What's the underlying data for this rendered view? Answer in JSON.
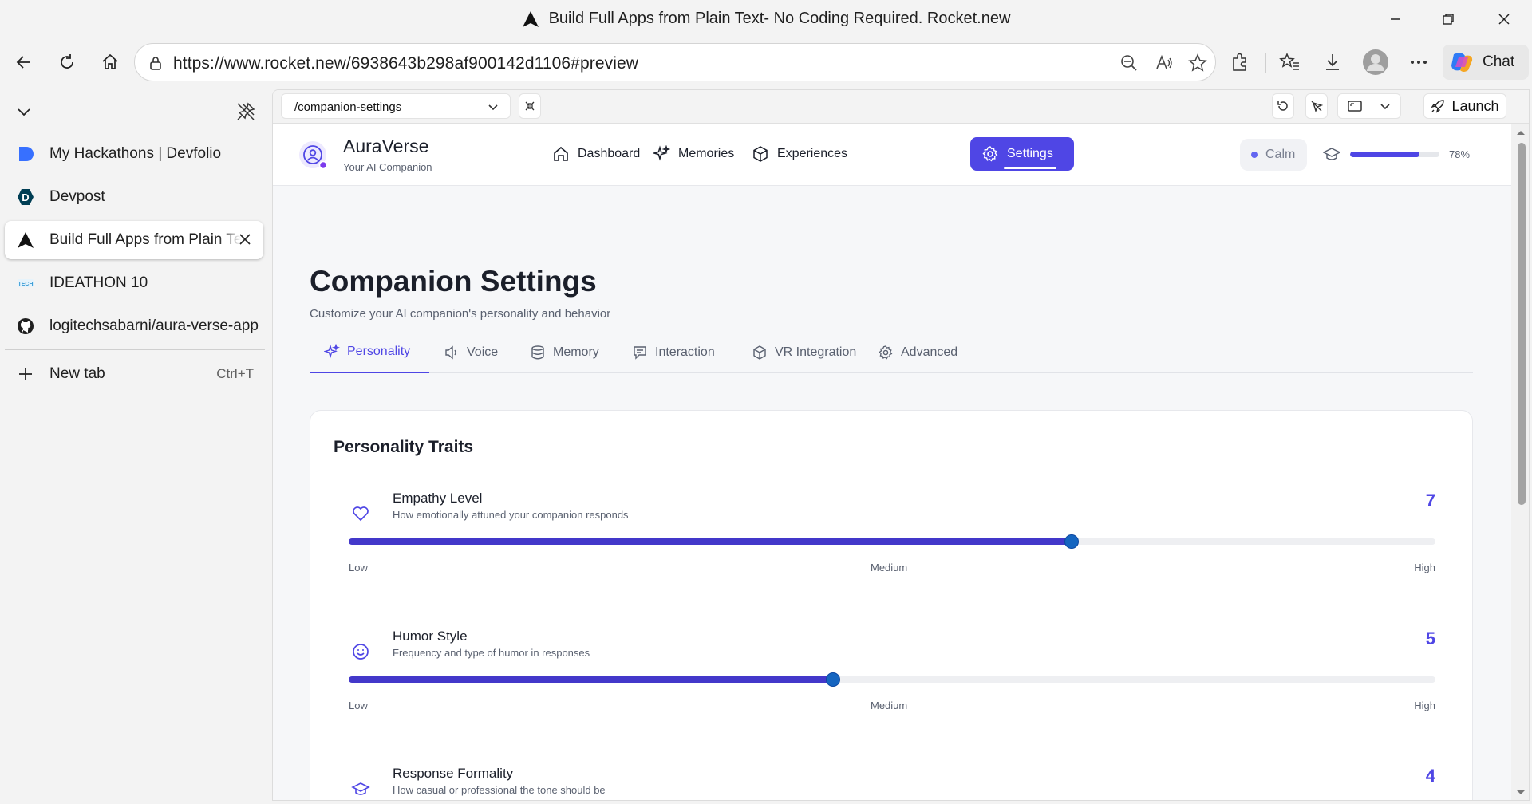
{
  "window": {
    "title": "Build Full Apps from Plain Text- No Coding Required. Rocket.new"
  },
  "browser": {
    "url": "https://www.rocket.new/6938643b298af900142d1106#preview",
    "chat_label": "Chat"
  },
  "tabs_sidebar": {
    "items": [
      {
        "label": "My Hackathons | Devfolio",
        "icon": "devfolio-icon"
      },
      {
        "label": "Devpost",
        "icon": "devpost-icon"
      },
      {
        "label": "Build Full Apps from Plain Text- No Coding Required. Rocket.new",
        "icon": "rocket-icon",
        "active": true
      },
      {
        "label": "IDEATHON 10",
        "icon": "ideathon-icon"
      },
      {
        "label": "logitechsabarni/aura-verse-app",
        "icon": "github-icon"
      }
    ],
    "new_tab_label": "New tab",
    "new_tab_shortcut": "Ctrl+T"
  },
  "preview_toolbar": {
    "route": "/companion-settings",
    "launch_label": "Launch"
  },
  "app": {
    "brand": "AuraVerse",
    "brand_sub": "Your AI Companion",
    "nav": [
      {
        "label": "Dashboard",
        "icon": "home-icon"
      },
      {
        "label": "Memories",
        "icon": "sparkles-icon"
      },
      {
        "label": "Experiences",
        "icon": "cube-icon"
      },
      {
        "label": "Settings",
        "icon": "gear-icon",
        "active": true
      }
    ],
    "mood": "Calm",
    "progress": 0.78,
    "progress_label": "78%",
    "accent": "#4f46e5"
  },
  "page": {
    "title": "Companion Settings",
    "subtitle": "Customize your AI companion's personality and behavior",
    "tabs": [
      {
        "label": "Personality",
        "icon": "sparkles-icon",
        "active": true
      },
      {
        "label": "Voice",
        "icon": "speaker-icon"
      },
      {
        "label": "Memory",
        "icon": "database-icon"
      },
      {
        "label": "Interaction",
        "icon": "chat-icon"
      },
      {
        "label": "VR Integration",
        "icon": "cube-icon"
      },
      {
        "label": "Advanced",
        "icon": "gear-icon"
      }
    ]
  },
  "personality": {
    "title": "Personality Traits",
    "scale": {
      "low": "Low",
      "medium": "Medium",
      "high": "High"
    },
    "traits": [
      {
        "name": "Empathy Level",
        "description": "How emotionally attuned your companion responds",
        "value": "7",
        "level": 0.665,
        "icon": "heart-icon"
      },
      {
        "name": "Humor Style",
        "description": "Frequency and type of humor in responses",
        "value": "5",
        "level": 0.446,
        "icon": "smile-icon"
      },
      {
        "name": "Response Formality",
        "description": "How casual or professional the tone should be",
        "value": "4",
        "icon": "graduation-cap-icon"
      }
    ]
  }
}
